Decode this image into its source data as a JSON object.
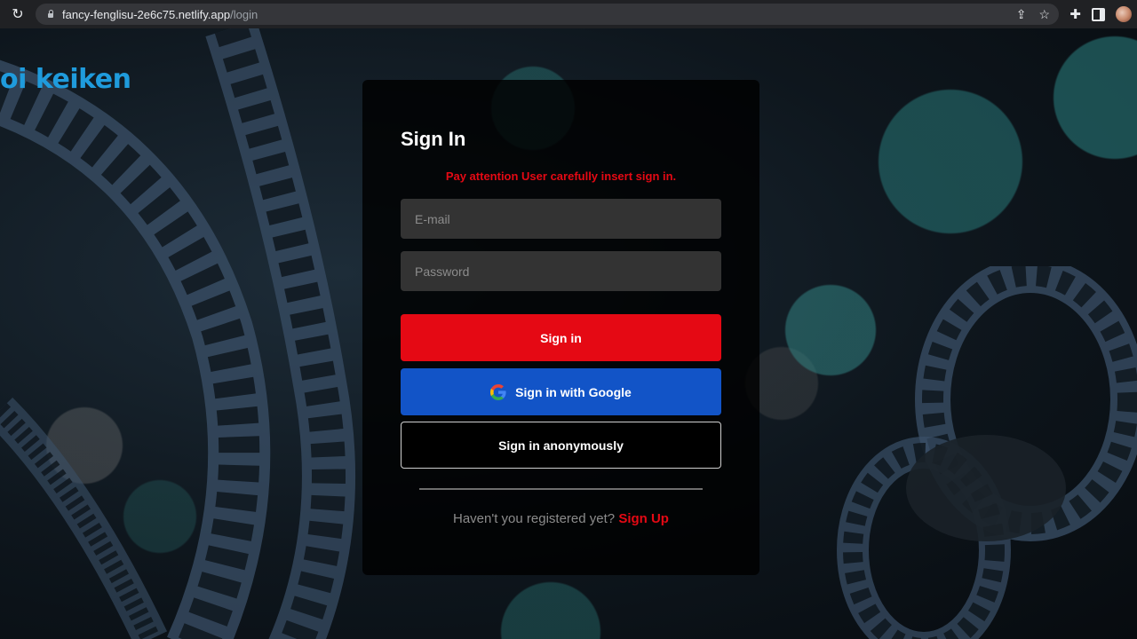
{
  "browser": {
    "url_host": "fancy-fenglisu-2e6c75.netlify.app",
    "url_path": "/login"
  },
  "logo": {
    "text": "oi keiken"
  },
  "signin": {
    "title": "Sign In",
    "warning": "Pay attention User carefully insert sign in.",
    "email_placeholder": "E-mail",
    "password_placeholder": "Password",
    "signin_button": "Sign in",
    "google_button": "Sign in with Google",
    "anonymous_button": "Sign in anonymously",
    "register_prompt": "Haven't you registered yet?",
    "signup_link": "Sign Up"
  },
  "colors": {
    "primary_red": "#e50914",
    "google_blue": "#1254c7",
    "logo_blue": "#1f9bdc"
  }
}
